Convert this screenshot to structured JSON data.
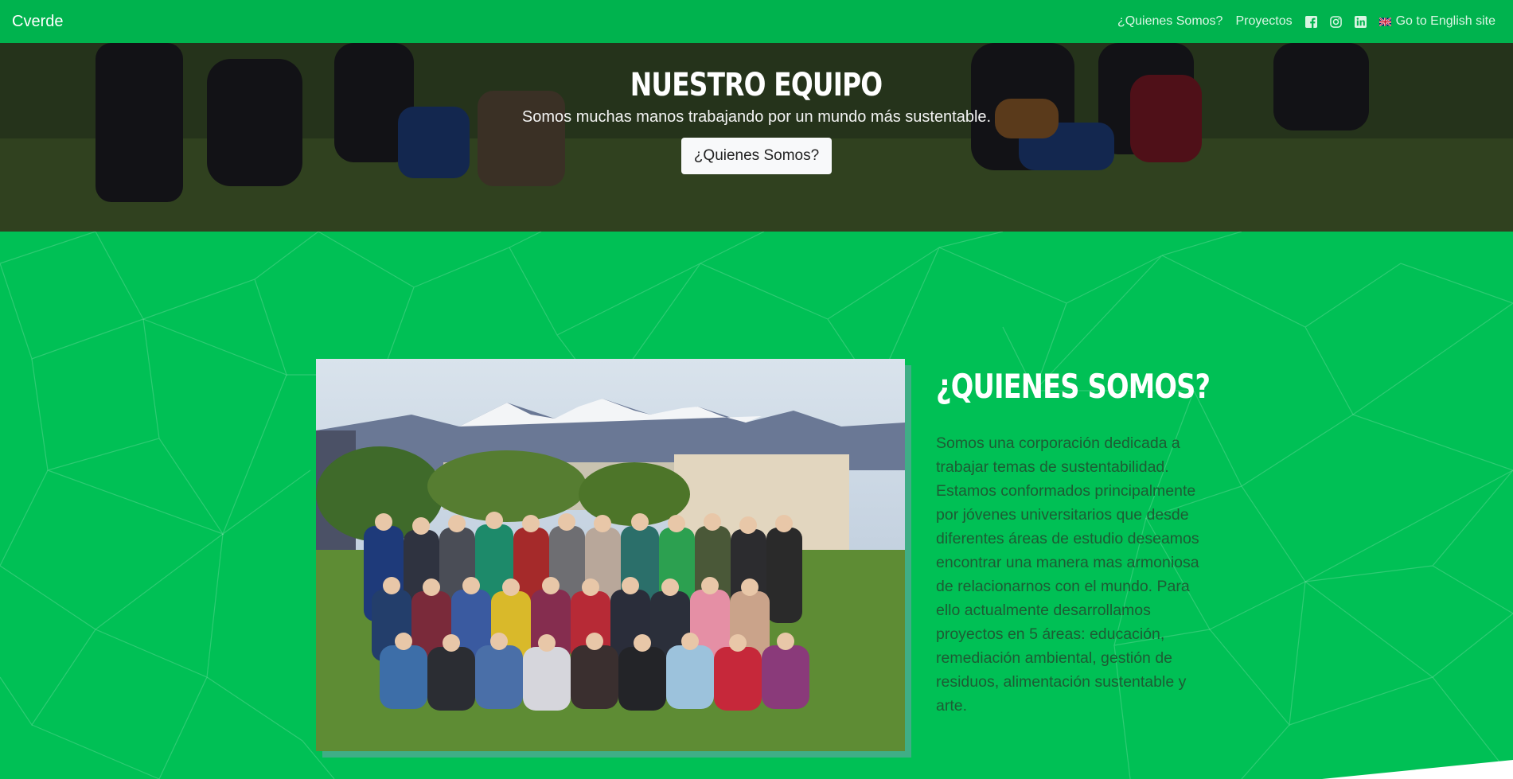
{
  "navbar": {
    "brand": "Cverde",
    "links": [
      "¿Quienes Somos?",
      "Proyectos"
    ],
    "social_icons": [
      "facebook-icon",
      "instagram-icon",
      "linkedin-icon"
    ],
    "language_link": "Go to English site",
    "language_icon": "uk-flag-icon",
    "background": "#00b34e"
  },
  "hero": {
    "title": "NUESTRO EQUIPO",
    "subtitle": "Somos muchas manos trabajando por un mundo más sustentable.",
    "button_label": "¿Quienes Somos?"
  },
  "about": {
    "title": "¿QUIENES SOMOS?",
    "text": "Somos una corporación dedicada a trabajar temas de sustentabilidad. Estamos conformados principalmente por jóvenes universitarios que desde diferentes áreas de estudio deseamos encontrar una manera mas armoniosa de relacionarnos con el mundo. Para ello actualmente desarrollamos proyectos en 5 áreas: educación, remediación ambiental, gestión de residuos, alimentación sustentable y arte.",
    "background": "#00c055",
    "text_color": "#1d5c34"
  }
}
